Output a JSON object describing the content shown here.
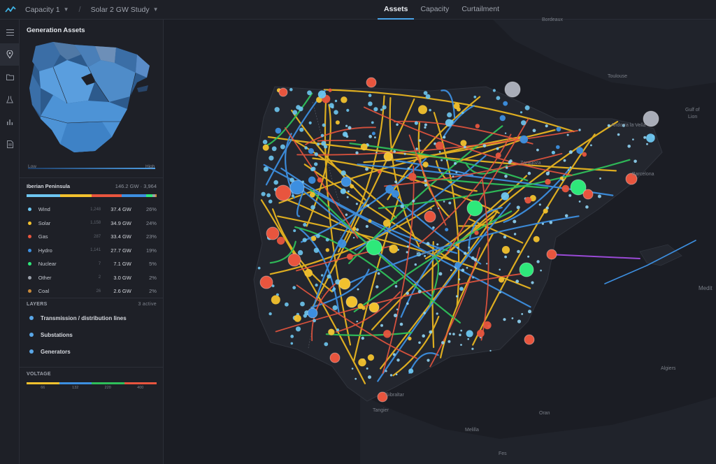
{
  "topbar": {
    "project": "Capacity 1",
    "study": "Solar 2 GW Study",
    "tabs": [
      "Assets",
      "Capacity",
      "Curtailment"
    ],
    "active_tab": "Assets"
  },
  "rail": {
    "icons": [
      "menu-icon",
      "map-pin-icon",
      "folder-icon",
      "flask-icon",
      "bar-chart-icon",
      "document-icon"
    ]
  },
  "panel": {
    "title": "Generation Assets",
    "legend_low": "Low",
    "legend_high": "High",
    "region": {
      "name": "Iberian Peninsula",
      "summary": "146.2 GW · 3,964"
    },
    "sources": [
      {
        "label": "Wind",
        "count": "1,248",
        "gw": "37.4 GW",
        "pct": "26%",
        "color": "#6ec6f0"
      },
      {
        "label": "Solar",
        "count": "1,158",
        "gw": "34.9 GW",
        "pct": "24%",
        "color": "#f2c12e"
      },
      {
        "label": "Gas",
        "count": "287",
        "gw": "33.4 GW",
        "pct": "23%",
        "color": "#e8553e"
      },
      {
        "label": "Hydro",
        "count": "1,141",
        "gw": "27.7 GW",
        "pct": "19%",
        "color": "#3d8fe0"
      },
      {
        "label": "Nuclear",
        "count": "7",
        "gw": "7.1 GW",
        "pct": "5%",
        "color": "#2ee87a"
      },
      {
        "label": "Other",
        "count": "2",
        "gw": "3.0 GW",
        "pct": "2%",
        "color": "#9aa0aa"
      },
      {
        "label": "Coal",
        "count": "26",
        "gw": "2.6 GW",
        "pct": "2%",
        "color": "#c98a3a"
      }
    ],
    "layers_title": "LAYERS",
    "layers_note": "3 active",
    "layers": [
      "Transmission / distribution lines",
      "Substations",
      "Generators"
    ],
    "voltage_title": "VOLTAGE",
    "voltage_levels": [
      "66",
      "132",
      "220",
      "400"
    ],
    "voltage_colors": [
      "#f2c12e",
      "#3d8fe0",
      "#2fbf5a",
      "#e8553e"
    ]
  },
  "map": {
    "labels": {
      "bordeaux": "Bordeaux",
      "toulouse": "Toulouse",
      "andorra": "Andorra la Vella",
      "gulf": "Gulf of",
      "lion": "Lion",
      "zaragoza": "Zaragoza",
      "barcelona": "Barcelona",
      "spain": "SPAIN",
      "gibraltar": "Gibraltar",
      "tangier": "Tangier",
      "oran": "Oran",
      "algiers": "Algiers",
      "melilla": "Melilla",
      "fes": "Fes",
      "medit": "Medit"
    }
  }
}
